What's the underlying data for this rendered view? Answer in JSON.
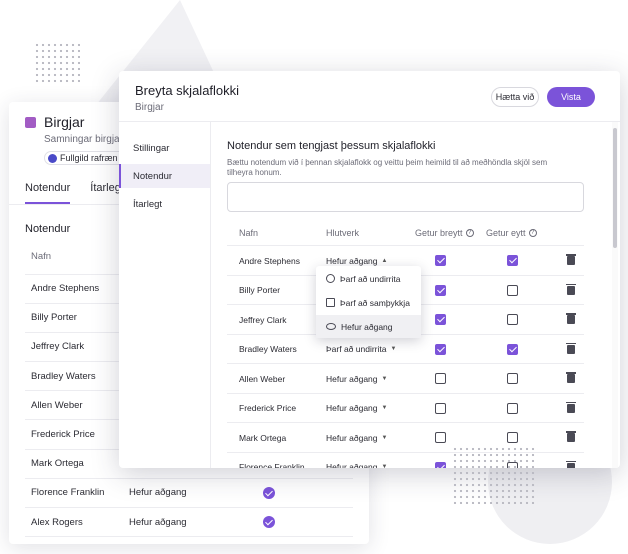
{
  "back_card": {
    "title": "Birgjar",
    "subtitle": "Samningar birgja",
    "badge": "Fullgild rafræn u",
    "tabs": [
      "Notendur",
      "Ítarlegt"
    ],
    "section_title": "Notendur",
    "column_name": "Nafn",
    "rows": [
      {
        "name": "Andre Stephens",
        "role": ""
      },
      {
        "name": "Billy Porter",
        "role": ""
      },
      {
        "name": "Jeffrey Clark",
        "role": ""
      },
      {
        "name": "Bradley Waters",
        "role": ""
      },
      {
        "name": "Allen Weber",
        "role": ""
      },
      {
        "name": "Frederick Price",
        "role": ""
      },
      {
        "name": "Mark Ortega",
        "role": ""
      },
      {
        "name": "Florence Franklin",
        "role": "Hefur aðgang"
      },
      {
        "name": "Alex Rogers",
        "role": "Hefur aðgang"
      }
    ]
  },
  "modal": {
    "title": "Breyta skjalaflokki",
    "subtitle": "Birgjar",
    "cancel_label": "Hætta við",
    "save_label": "Vista",
    "nav": [
      "Stillingar",
      "Notendur",
      "Ítarlegt"
    ],
    "section_title": "Notendur sem tengjast þessum skjalaflokki",
    "section_desc": "Bættu notendum við í þennan skjalaflokk og veittu þeim heimild til að meðhöndla skjöl sem tilheyra honum.",
    "columns": {
      "name": "Nafn",
      "role": "Hlutverk",
      "can_edit": "Getur breytt",
      "can_delete": "Getur eytt"
    },
    "rows": [
      {
        "name": "Andre Stephens",
        "role": "Hefur aðgang",
        "can_edit": true,
        "can_delete": true,
        "open": true
      },
      {
        "name": "Billy Porter",
        "role": "",
        "can_edit": true,
        "can_delete": false
      },
      {
        "name": "Jeffrey Clark",
        "role": "",
        "can_edit": true,
        "can_delete": false
      },
      {
        "name": "Bradley Waters",
        "role": "Þarf að undirrita",
        "can_edit": true,
        "can_delete": true
      },
      {
        "name": "Allen Weber",
        "role": "Hefur aðgang",
        "can_edit": false,
        "can_delete": false
      },
      {
        "name": "Frederick Price",
        "role": "Hefur aðgang",
        "can_edit": false,
        "can_delete": false
      },
      {
        "name": "Mark Ortega",
        "role": "Hefur aðgang",
        "can_edit": false,
        "can_delete": false
      },
      {
        "name": "Florence Franklin",
        "role": "Hefur aðgang",
        "can_edit": true,
        "can_delete": false
      }
    ],
    "dropdown_options": [
      {
        "label": "Þarf að undirrita",
        "icon": "circle-check-icon"
      },
      {
        "label": "Þarf að samþykkja",
        "icon": "square-check-icon"
      },
      {
        "label": "Hefur aðgang",
        "icon": "eye-icon",
        "selected": true
      }
    ]
  },
  "colors": {
    "accent": "#7b53d9",
    "swatch": "#a25cc4"
  }
}
